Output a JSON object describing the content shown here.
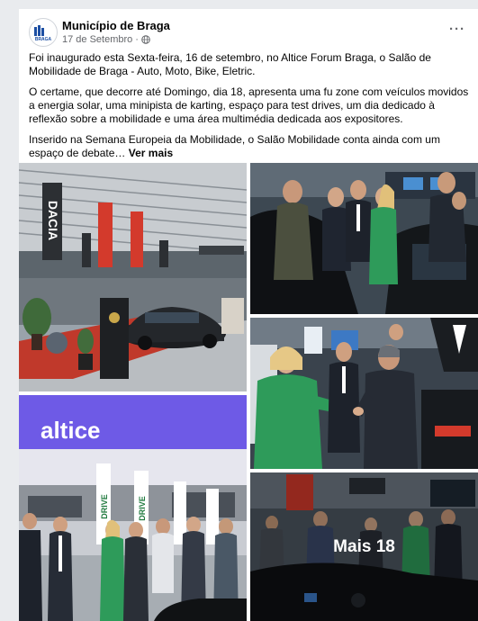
{
  "post": {
    "author": "Município de Braga",
    "date": "17 de Setembro",
    "date_separator": "·",
    "menu_glyph": "···",
    "avatar_text": "BRAGA",
    "paragraphs": [
      "Foi inaugurado esta Sexta-feira, 16 de setembro, no Altice Forum Braga, o Salão de Mobilidade de Braga - Auto, Moto, Bike, Eletric.",
      "O certame, que decorre até Domingo, dia 18, apresenta uma fu zone com veículos movidos a energia solar, uma minipista de karting, espaço para test drives, um dia dedicado à reflexão sobre a mobilidade e uma área multimédia dedicada aos expositores."
    ],
    "truncated_paragraph": "Inserido na Semana Europeia da Mobilidade, o Salão Mobilidade conta ainda com um espaço de debate…",
    "see_more": "Ver mais"
  },
  "photos": {
    "more_count_label": "Mais 18",
    "signage": {
      "brand_banner": "DACIA",
      "altice_sign": "altice",
      "drive_banner": "DRIVE"
    }
  },
  "colors": {
    "page_bg": "#e9ebee",
    "card_bg": "#ffffff",
    "secondary_text": "#65676b",
    "altice_purple": "#6e5ae6",
    "carpet_red": "#c0392b",
    "jacket_green": "#2e9b5a",
    "banner_red": "#d33a2c"
  },
  "icons": {
    "avatar": "municipality-logo",
    "privacy": "globe-icon",
    "menu": "more-options-icon"
  }
}
